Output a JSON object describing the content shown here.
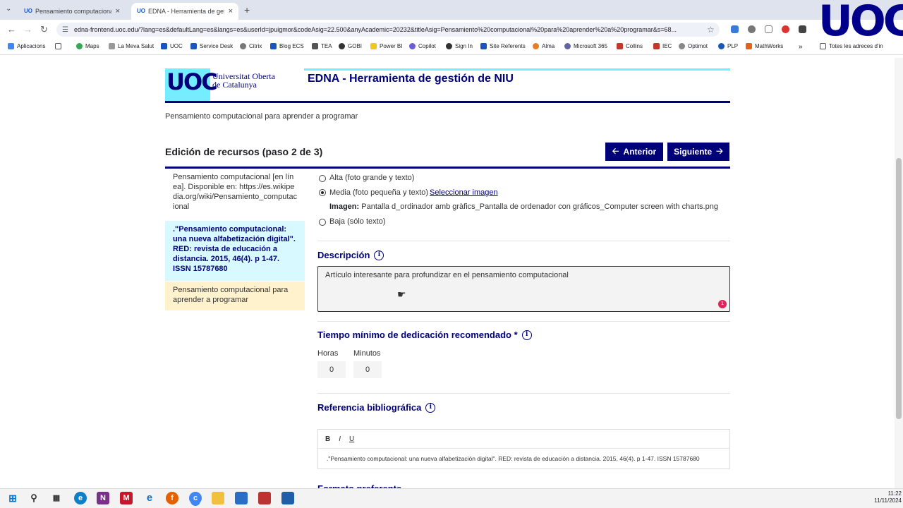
{
  "browser": {
    "tabs": [
      {
        "title": "Pensamiento computacional pa",
        "active": false
      },
      {
        "title": "EDNA - Herramienta de gestió",
        "active": true
      }
    ],
    "url": "edna-frontend.uoc.edu/?lang=es&defaultLang=es&langs=es&userId=jpuigmor&codeAsig=22.500&anyAcademic=20232&titleAsig=Pensamiento%20computacional%20para%20aprender%20a%20programar&s=68...",
    "bookmarks": [
      "Aplicacions",
      "Maps",
      "La Meva Salut",
      "UOC",
      "Service Desk",
      "Citrix",
      "Blog ECS",
      "TEA",
      "GOBI",
      "Power BI",
      "Copilot",
      "Sign In",
      "Site Referents",
      "Alma",
      "Microsoft 365",
      "Collins",
      "IEC",
      "Optimot",
      "PLP",
      "MathWorks"
    ],
    "other_bookmarks": "Totes les adreces d'in",
    "overlay_logo": "UOC"
  },
  "header": {
    "logo": "UOC",
    "university_line1": "Universitat Oberta",
    "university_line2": "de Catalunya",
    "app_title": "EDNA - Herramienta de gestión de NIU"
  },
  "course_name": "Pensamiento computacional para aprender a programar",
  "step": {
    "title": "Edición de recursos (paso 2 de 3)",
    "prev_label": "Anterior",
    "next_label": "Siguiente"
  },
  "resources": [
    {
      "text": "Pensamiento computacional [en línea]. Disponible en: https://es.wikipedia.org/wiki/Pensamiento_computacional",
      "state": "normal"
    },
    {
      "text": ".\"Pensamiento computacional: una nueva alfabetización digital\". RED: revista de educación a distancia. 2015, 46(4). p 1-47. ISSN 15787680",
      "state": "selected"
    },
    {
      "text": "Pensamiento computacional para aprender a programar",
      "state": "highlight"
    }
  ],
  "visibility": {
    "options": [
      {
        "label": "Alta (foto grande y texto)",
        "selected": false
      },
      {
        "label": "Media (foto pequeña y texto)",
        "selected": true
      },
      {
        "label": "Baja (sólo texto)",
        "selected": false
      }
    ],
    "select_image_label": "Seleccionar imagen",
    "image_label": "Imagen:",
    "image_value": "Pantalla d_ordinador amb gràfics_Pantalla de ordenador con gráficos_Computer screen with charts.png"
  },
  "description": {
    "label": "Descripción",
    "value": "Artículo interesante para profundizar en el pensamiento computacional",
    "badge": "1"
  },
  "time": {
    "label": "Tiempo mínimo de dedicación recomendado *",
    "hours_label": "Horas",
    "hours_value": "0",
    "minutes_label": "Minutos",
    "minutes_value": "0"
  },
  "reference": {
    "label": "Referencia bibliográfica",
    "toolbar": [
      "B",
      "I",
      "U"
    ],
    "value": ".\"Pensamiento computacional: una nueva alfabetización digital\". RED: revista de educación a distancia. 2015, 46(4). p 1-47. ISSN 15787680"
  },
  "next_section_label": "Formato preferente",
  "clock": {
    "time": "11:22",
    "date": "11/11/2024"
  },
  "colors": {
    "brand_navy": "#000078",
    "brand_cyan": "#73edff",
    "selected_bg": "#d7f9ff",
    "highlight_bg": "#fff2cc"
  }
}
